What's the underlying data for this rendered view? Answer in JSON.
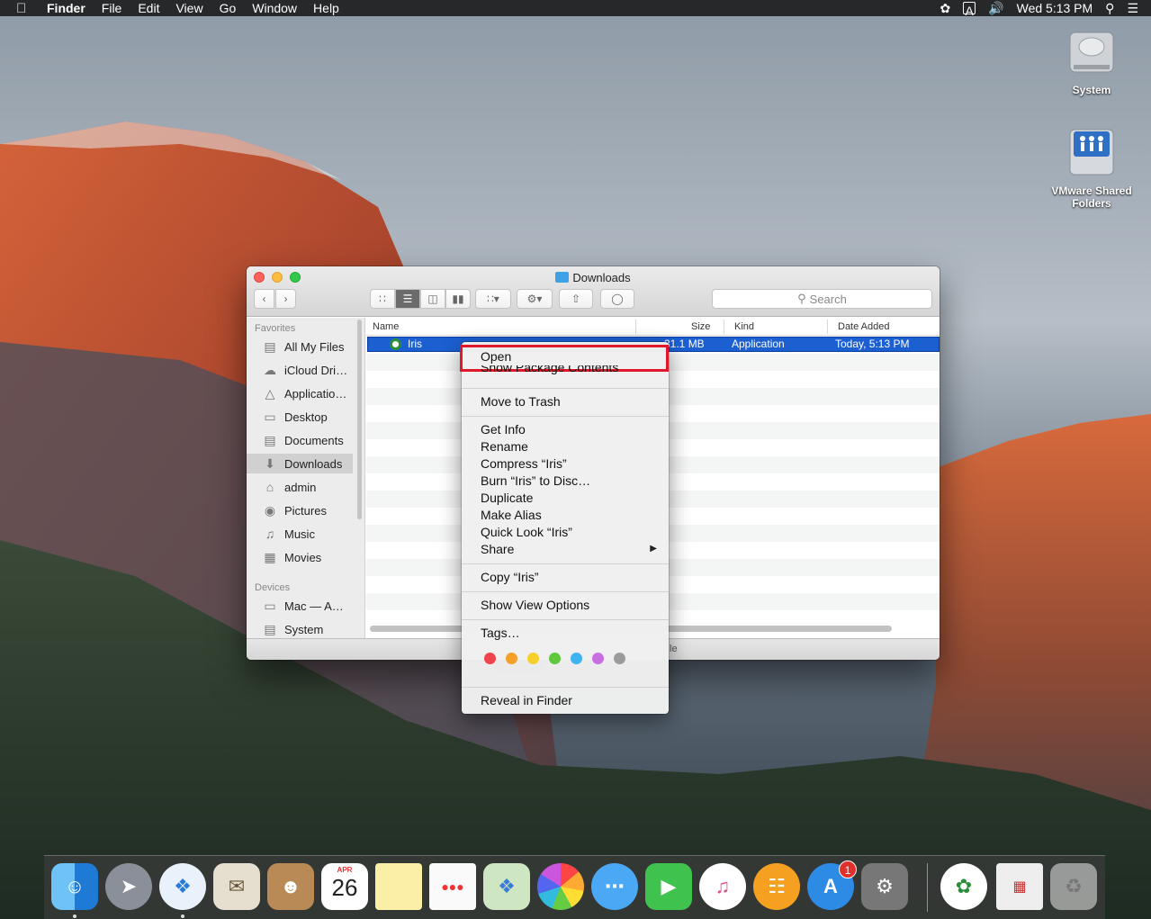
{
  "menubar": {
    "app_name": "Finder",
    "menus": [
      "File",
      "Edit",
      "View",
      "Go",
      "Window",
      "Help"
    ],
    "input_source": "A",
    "clock": "Wed 5:13 PM"
  },
  "desktop": {
    "icons": [
      {
        "label": "System"
      },
      {
        "label": "VMware Shared Folders"
      }
    ]
  },
  "finder": {
    "title": "Downloads",
    "search_placeholder": "Search",
    "sidebar": {
      "favorites_header": "Favorites",
      "favorites": [
        {
          "label": "All My Files",
          "icon": "all-files-icon"
        },
        {
          "label": "iCloud Dri…",
          "icon": "cloud-icon"
        },
        {
          "label": "Applicatio…",
          "icon": "applications-icon"
        },
        {
          "label": "Desktop",
          "icon": "desktop-icon"
        },
        {
          "label": "Documents",
          "icon": "documents-icon"
        },
        {
          "label": "Downloads",
          "icon": "downloads-icon",
          "selected": true
        },
        {
          "label": "admin",
          "icon": "home-icon"
        },
        {
          "label": "Pictures",
          "icon": "camera-icon"
        },
        {
          "label": "Music",
          "icon": "music-note-icon"
        },
        {
          "label": "Movies",
          "icon": "film-icon"
        }
      ],
      "devices_header": "Devices",
      "devices": [
        {
          "label": "Mac — A…",
          "icon": "computer-icon"
        },
        {
          "label": "System",
          "icon": "disk-icon"
        }
      ]
    },
    "columns": {
      "name": "Name",
      "size": "Size",
      "kind": "Kind",
      "date_added": "Date Added"
    },
    "files": [
      {
        "name": "Iris",
        "size": "31.1 MB",
        "kind": "Application",
        "date_added": "Today, 5:13 PM",
        "selected": true
      }
    ],
    "status_text": "le"
  },
  "context_menu": {
    "open": "Open",
    "show_package_contents": "Show Package Contents",
    "move_to_trash": "Move to Trash",
    "get_info": "Get Info",
    "rename": "Rename",
    "compress": "Compress “Iris”",
    "burn": "Burn “Iris” to Disc…",
    "duplicate": "Duplicate",
    "make_alias": "Make Alias",
    "quick_look": "Quick Look “Iris”",
    "share": "Share",
    "copy": "Copy “Iris”",
    "show_view_options": "Show View Options",
    "tags": "Tags…",
    "tag_colors": [
      "#f0454b",
      "#f6a02b",
      "#f7d02c",
      "#5fc93b",
      "#3fb2f0",
      "#c96ee0",
      "#9b9b9b"
    ],
    "reveal_in_finder": "Reveal in Finder",
    "highlight_color": "#e0182b"
  },
  "dock": {
    "calendar_month": "APR",
    "calendar_day": "26",
    "app_store_badge": "1",
    "apps": [
      "finder-icon",
      "launchpad-icon",
      "safari-icon",
      "mail-icon",
      "contacts-icon",
      "calendar-icon",
      "notes-icon",
      "reminders-icon",
      "maps-icon",
      "photos-icon",
      "messages-icon",
      "facetime-icon",
      "itunes-icon",
      "ibooks-icon",
      "app-store-icon",
      "system-preferences-icon",
      "iris-icon",
      "preview-icon",
      "trash-icon"
    ]
  }
}
